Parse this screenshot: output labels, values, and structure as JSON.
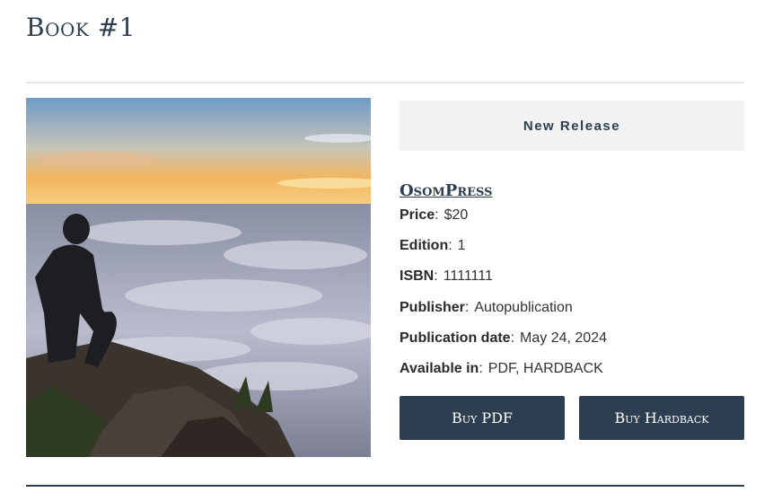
{
  "page": {
    "title": "Book #1"
  },
  "product": {
    "badge": "New Release",
    "publisher_link": "OsomPress",
    "details": [
      {
        "key": "Price",
        "value": "$20"
      },
      {
        "key": "Edition",
        "value": "1"
      },
      {
        "key": "ISBN",
        "value": "1111111"
      },
      {
        "key": "Publisher",
        "value": "Autopublication"
      },
      {
        "key": "Publication date",
        "value": "May 24, 2024"
      },
      {
        "key": "Available in",
        "value": "PDF, HARDBACK"
      }
    ],
    "buttons": {
      "pdf": "Buy PDF",
      "hardback": "Buy Hardback"
    }
  }
}
